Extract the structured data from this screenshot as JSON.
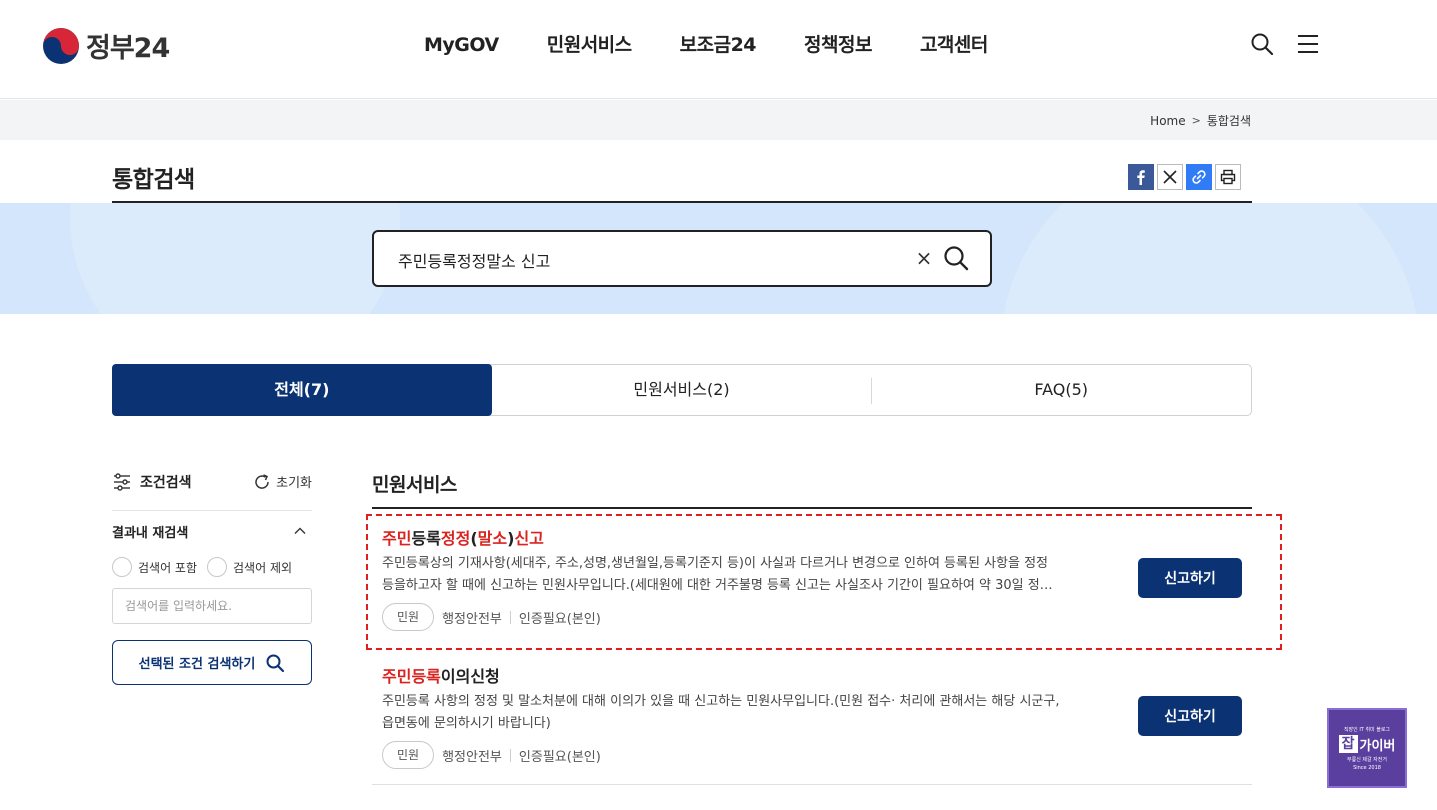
{
  "header": {
    "logo_text": "정부24",
    "nav": [
      "MyGOV",
      "민원서비스",
      "보조금24",
      "정책정보",
      "고객센터"
    ]
  },
  "breadcrumb": {
    "home": "Home",
    "current": "통합검색"
  },
  "page": {
    "title": "통합검색"
  },
  "search": {
    "query": "주민등록정정말소 신고",
    "clear_label": "×"
  },
  "tabs": [
    {
      "label": "전체(7)",
      "active": true
    },
    {
      "label": "민원서비스(2)",
      "active": false
    },
    {
      "label": "FAQ(5)",
      "active": false
    }
  ],
  "filter": {
    "title": "조건검색",
    "reset": "초기화",
    "refine_title": "결과내 재검색",
    "include_label": "검색어 포함",
    "exclude_label": "검색어 제외",
    "input_placeholder": "검색어를 입력하세요.",
    "apply_label": "선택된 조건 검색하기"
  },
  "results": {
    "section_title": "민원서비스",
    "items": [
      {
        "title_parts": [
          {
            "text": "주민",
            "hl": true
          },
          {
            "text": "등록",
            "hl": false
          },
          {
            "text": "정정",
            "hl": true
          },
          {
            "text": "(",
            "hl": false
          },
          {
            "text": "말소",
            "hl": true
          },
          {
            "text": ")",
            "hl": false
          },
          {
            "text": "신고",
            "hl": true
          }
        ],
        "desc_line1": "주민등록상의 기재사항(세대주, 주소,성명,생년월일,등록기준지 등)이 사실과 다르거나 변경으로 인하여 등록된 사항을 정정",
        "desc_line2": "등을하고자 할 때에 신고하는 민원사무입니다.(세대원에 대한 거주불명 등록 신고는 사실조사 기간이 필요하여 약 30일 정…",
        "badge": "민원",
        "agency": "행정안전부",
        "auth": "인증필요(본인)",
        "button": "신고하기"
      },
      {
        "title_parts": [
          {
            "text": "주민등록",
            "hl": true
          },
          {
            "text": "이의신청",
            "hl": false
          }
        ],
        "desc_line1": "주민등록 사항의 정정 및 말소처분에 대해 이의가 있을 때 신고하는 민원사무입니다.(민원 접수· 처리에 관해서는 해당 시군구,",
        "desc_line2": "읍면동에 문의하시기 바랍니다)",
        "badge": "민원",
        "agency": "행정안전부",
        "auth": "인증필요(본인)",
        "button": "신고하기"
      }
    ]
  },
  "float_badge": {
    "top": "직장인 IT 취미 블로그",
    "char": "잡",
    "name": "가이버",
    "sub": "무릎신 제갈 자전거",
    "since": "Since 2018"
  },
  "colors": {
    "primary": "#0b3373",
    "highlight": "#d9231f",
    "banner": "#d3e6fb"
  }
}
